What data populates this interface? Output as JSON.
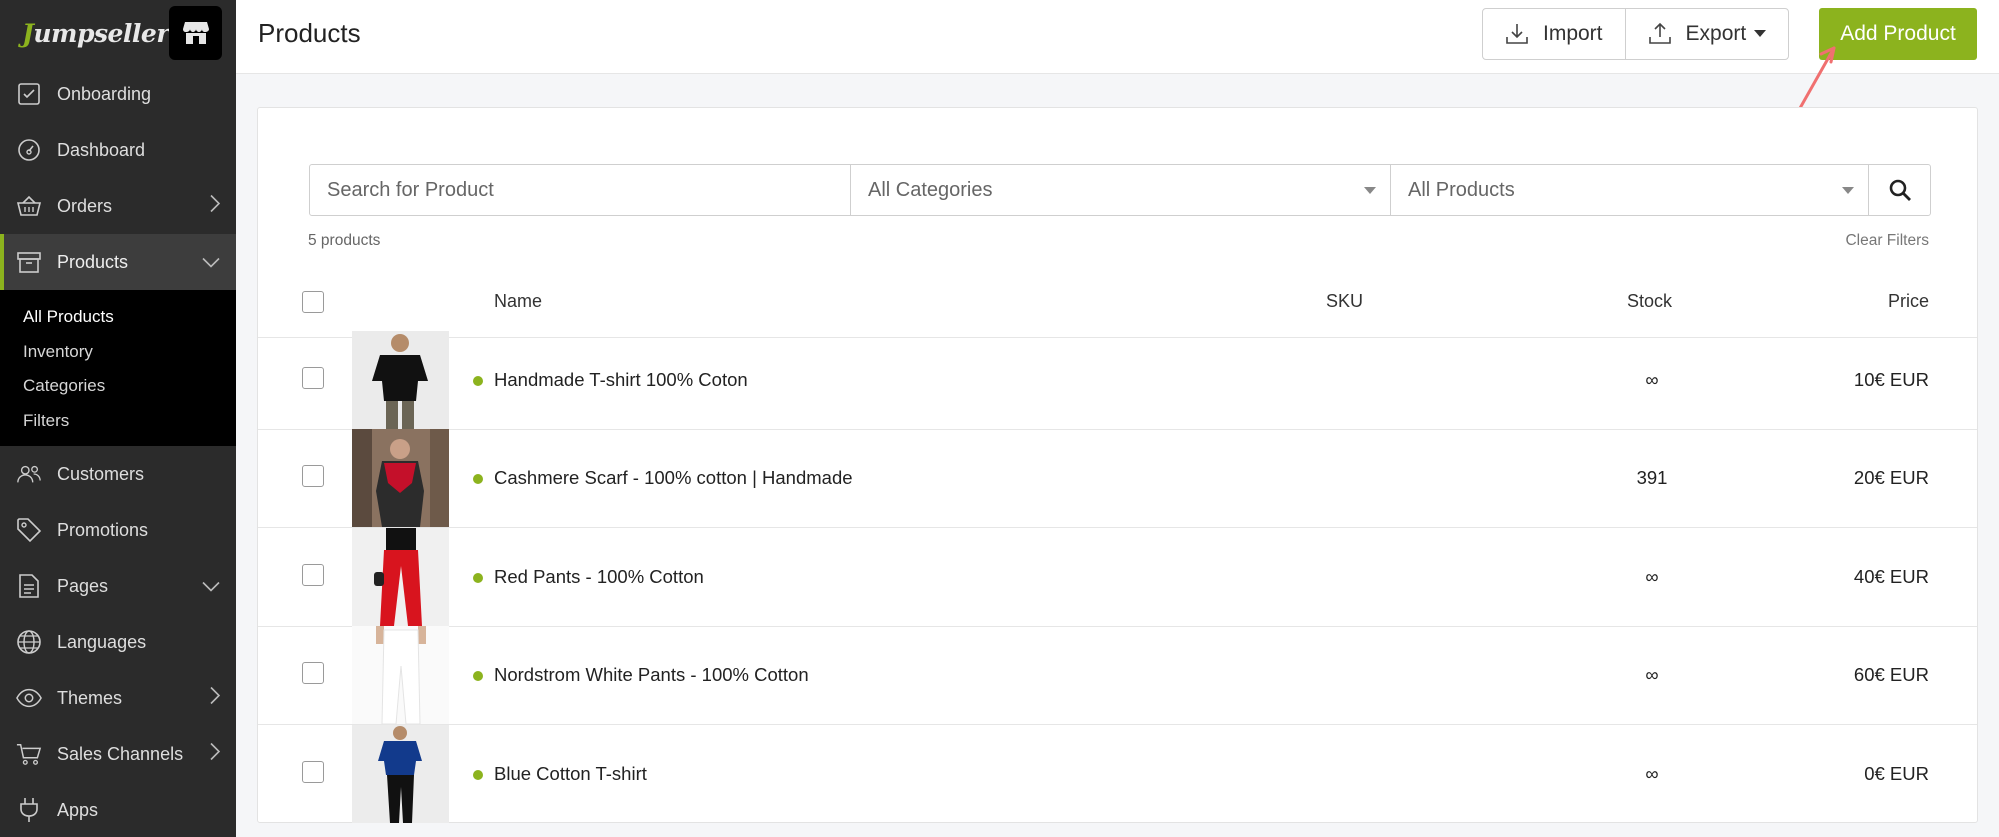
{
  "brand": {
    "logo_text": "umpseller",
    "logo_initial": "J",
    "accent": "#8cb31e",
    "store_icon": "store-icon"
  },
  "sidebar": {
    "items": [
      {
        "label": "Onboarding",
        "icon": "checkbox-icon"
      },
      {
        "label": "Dashboard",
        "icon": "gauge-icon"
      },
      {
        "label": "Orders",
        "icon": "basket-icon",
        "chevron": "right"
      },
      {
        "label": "Products",
        "icon": "box-icon",
        "chevron": "down",
        "active": true
      },
      {
        "label": "Customers",
        "icon": "users-icon"
      },
      {
        "label": "Promotions",
        "icon": "tag-icon"
      },
      {
        "label": "Pages",
        "icon": "page-icon",
        "chevron": "down"
      },
      {
        "label": "Languages",
        "icon": "globe-icon"
      },
      {
        "label": "Themes",
        "icon": "eye-icon",
        "chevron": "right"
      },
      {
        "label": "Sales Channels",
        "icon": "cart-icon",
        "chevron": "right"
      },
      {
        "label": "Apps",
        "icon": "plug-icon"
      }
    ],
    "products_sub": [
      "All Products",
      "Inventory",
      "Categories",
      "Filters"
    ]
  },
  "header": {
    "title": "Products",
    "import_label": "Import",
    "export_label": "Export",
    "add_label": "Add Product"
  },
  "filters": {
    "search_placeholder": "Search for Product",
    "category": "All Categories",
    "product_filter": "All Products"
  },
  "count_text": "5 products",
  "clear_filters": "Clear Filters",
  "table": {
    "columns": {
      "name": "Name",
      "sku": "SKU",
      "stock": "Stock",
      "price": "Price"
    },
    "rows": [
      {
        "name": "Handmade T-shirt 100% Coton",
        "sku": "",
        "stock": "∞",
        "price": "10€ EUR"
      },
      {
        "name": "Cashmere Scarf - 100% cotton | Handmade",
        "sku": "",
        "stock": "391",
        "price": "20€ EUR"
      },
      {
        "name": "Red Pants - 100% Cotton",
        "sku": "",
        "stock": "∞",
        "price": "40€ EUR"
      },
      {
        "name": "Nordstrom White Pants - 100% Cotton",
        "sku": "",
        "stock": "∞",
        "price": "60€ EUR"
      },
      {
        "name": "Blue Cotton T-shirt",
        "sku": "",
        "stock": "∞",
        "price": "0€ EUR"
      }
    ]
  }
}
